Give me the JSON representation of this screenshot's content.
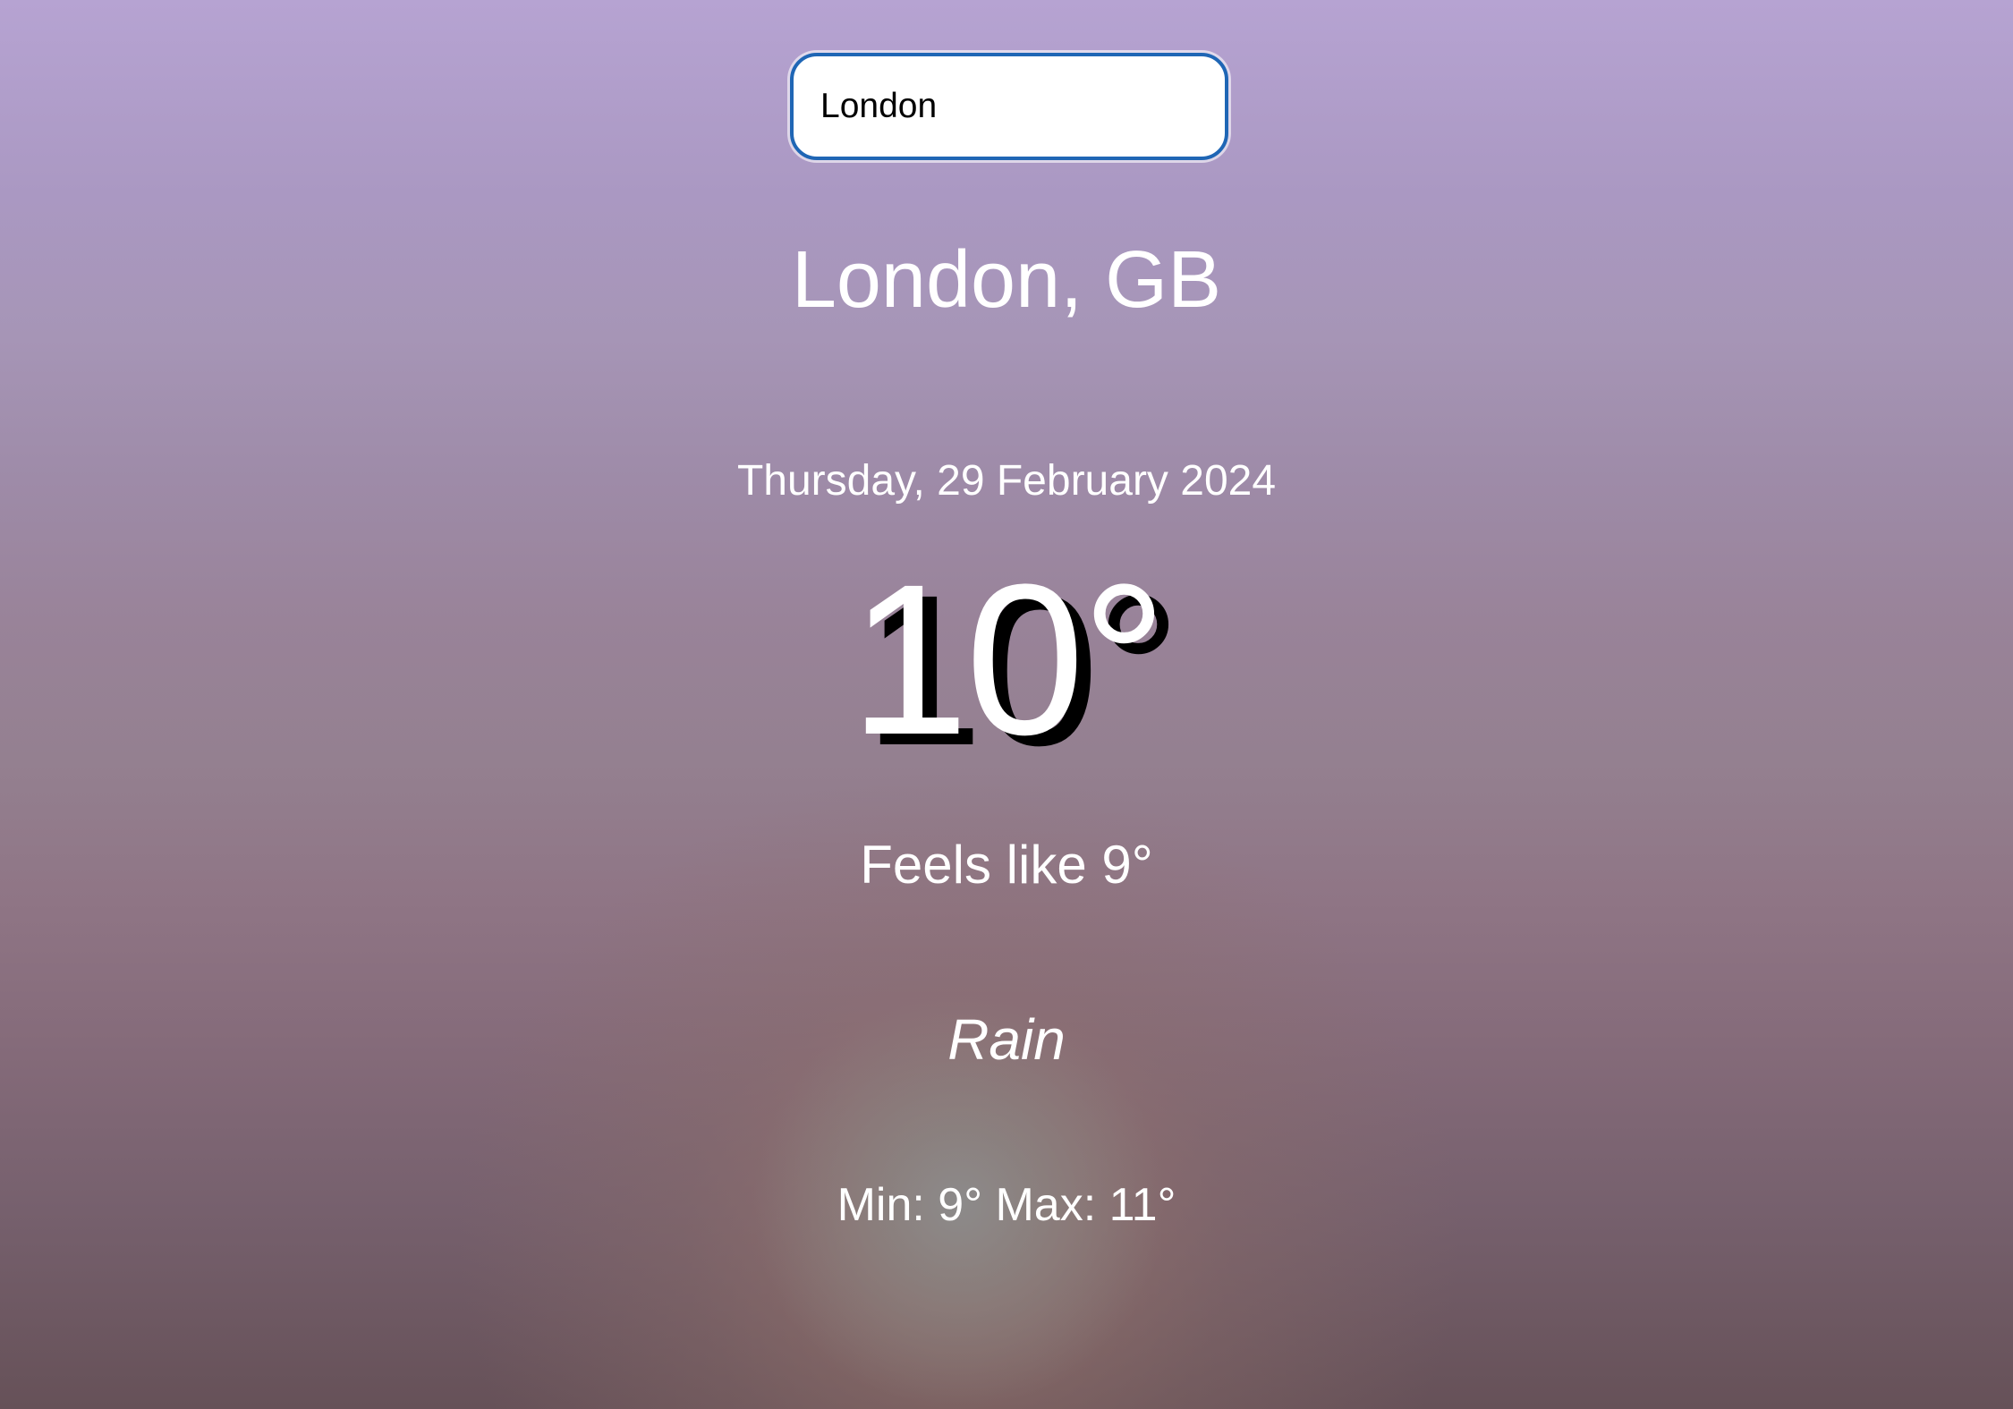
{
  "search": {
    "value": "London"
  },
  "weather": {
    "location": "London, GB",
    "date": "Thursday, 29 February 2024",
    "temperature": "10°",
    "feels_like": "Feels like 9°",
    "condition": "Rain",
    "min_max": "Min: 9° Max: 11°"
  },
  "colors": {
    "input_border": "#1f66b5",
    "text": "#ffffff",
    "temp_shadow": "#000000"
  }
}
